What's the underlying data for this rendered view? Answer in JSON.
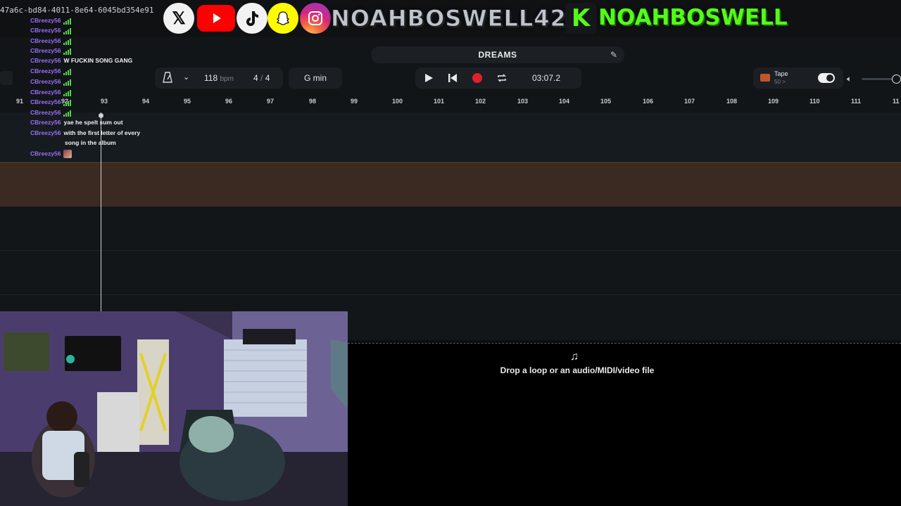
{
  "overlay": {
    "hash_text": "47a6c-bd84-4011-8e64-6045bd354e91",
    "social_icons": [
      "x-icon",
      "youtube-icon",
      "tiktok-icon",
      "snapchat-icon",
      "instagram-icon"
    ],
    "handle_primary": "NOAHBOSWELL420",
    "kick_letter": "K",
    "handle_kick": "NOAHBOSWELL",
    "colors": {
      "kick_green": "#53fc18",
      "youtube_red": "#ff0000",
      "snapchat_yellow": "#fffc00"
    }
  },
  "chat": [
    {
      "user": "CBreezy56",
      "msg": "",
      "signal": true
    },
    {
      "user": "CBreezy56",
      "msg": "",
      "signal": true
    },
    {
      "user": "CBreezy56",
      "msg": "",
      "signal": true
    },
    {
      "user": "CBreezy56",
      "msg": "",
      "signal": true
    },
    {
      "user": "CBreezy56",
      "msg": "W FUCKIN SONG GANG",
      "signal": false
    },
    {
      "user": "CBreezy56",
      "msg": "",
      "signal": true
    },
    {
      "user": "CBreezy56",
      "msg": "",
      "signal": true
    },
    {
      "user": "CBreezy56",
      "msg": "",
      "signal": true
    },
    {
      "user": "CBreezy56",
      "msg": "",
      "signal": true
    },
    {
      "user": "CBreezy56",
      "msg": "",
      "signal": true
    },
    {
      "user": "CBreezy56",
      "msg": "yae he spelt sum out",
      "signal": false
    },
    {
      "user": "CBreezy56",
      "msg": "with the first letter of every",
      "signal": false
    },
    {
      "user": "",
      "msg": "song in the album",
      "signal": false
    },
    {
      "user": "CBreezy56",
      "msg": "",
      "signal": false,
      "emote": true
    }
  ],
  "daw": {
    "project_title": "DREAMS",
    "tempo": "118",
    "tempo_unit": "bpm",
    "time_sig_num": "4",
    "time_sig_sep": "/",
    "time_sig_den": "4",
    "key": "G min",
    "time_display": "03:07.2",
    "tape_label": "Tape",
    "tape_value": "50 >",
    "tape_toggle_on": true,
    "ruler": [
      "91",
      "92",
      "93",
      "94",
      "95",
      "96",
      "97",
      "98",
      "99",
      "100",
      "101",
      "102",
      "103",
      "104",
      "105",
      "106",
      "107",
      "108",
      "109",
      "110",
      "111",
      "11"
    ],
    "drop_text": "Drop a loop or an audio/MIDI/video file",
    "record_color": "#e0212a"
  }
}
